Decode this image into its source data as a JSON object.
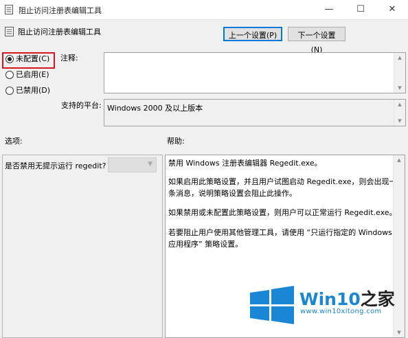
{
  "window": {
    "title": "阻止访问注册表编辑工具",
    "minimize": "—",
    "maximize": "☐",
    "close": "✕"
  },
  "policy_title": "阻止访问注册表编辑工具",
  "nav": {
    "prev_label": "上一个设置(P)",
    "next_label": "下一个设置(N)"
  },
  "state": {
    "not_configured": "未配置(C)",
    "enabled": "已启用(E)",
    "disabled": "已禁用(D)",
    "selected": "not_configured"
  },
  "comment_label": "注释:",
  "comment_value": "",
  "platform_label": "支持的平台:",
  "platform_value": "Windows 2000 及以上版本",
  "options_label": "选项:",
  "help_label": "帮助:",
  "options": {
    "row_label": "是否禁用无提示运行 regedit?",
    "dropdown_value": ""
  },
  "help": {
    "p1": "禁用 Windows 注册表编辑器 Regedit.exe。",
    "p2": "如果启用此策略设置，并且用户试图启动 Regedit.exe，则会出现一条消息，说明策略设置会阻止此操作。",
    "p3": "如果禁用或未配置此策略设置，则用户可以正常运行 Regedit.exe。",
    "p4": "若要阻止用户使用其他管理工具，请使用 “只运行指定的 Windows 应用程序” 策略设置。"
  },
  "watermark": {
    "brand": "Win10",
    "brand_suffix": "之家",
    "url": "www.win10xitong.com",
    "colors": {
      "blue": "#1a86d4"
    }
  }
}
